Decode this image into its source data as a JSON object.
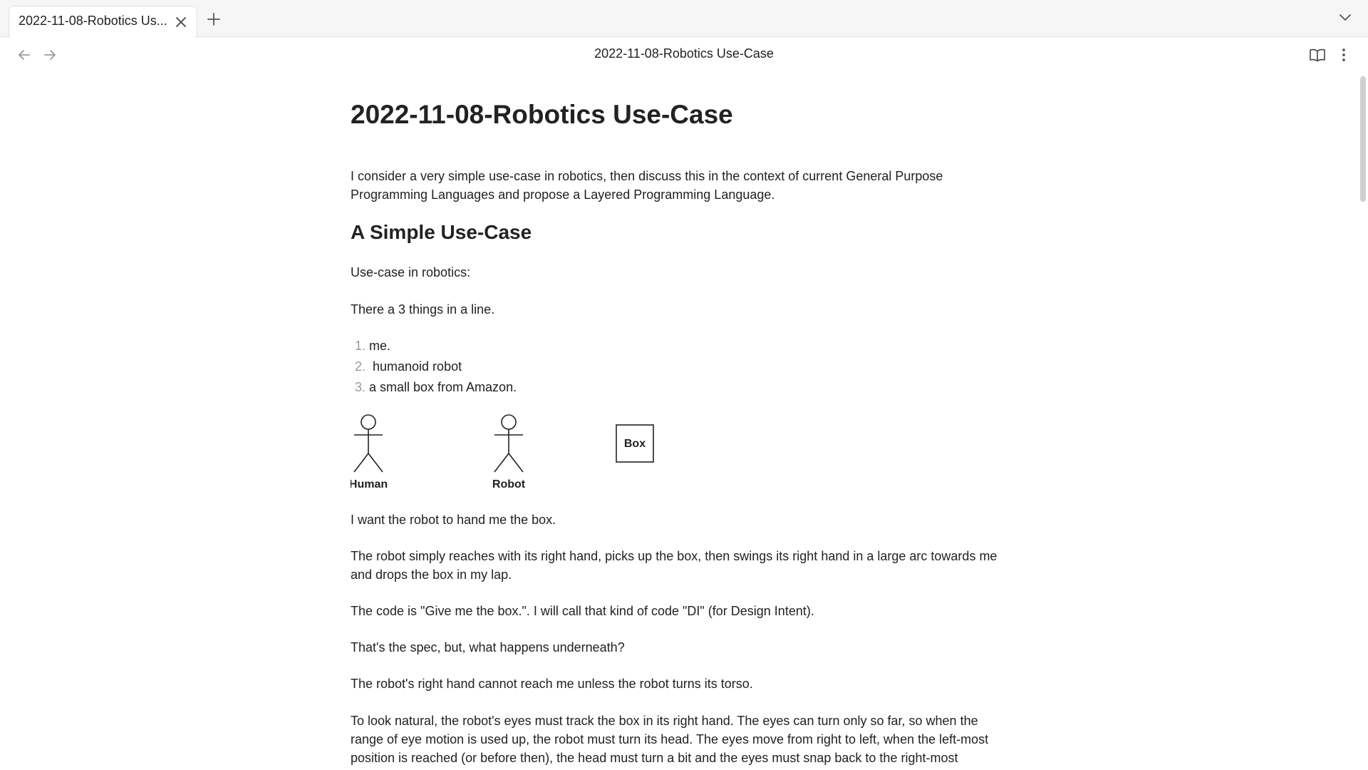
{
  "tab": {
    "title": "2022-11-08-Robotics Us..."
  },
  "navbar": {
    "title": "2022-11-08-Robotics Use-Case"
  },
  "doc": {
    "title": "2022-11-08-Robotics Use-Case",
    "intro_line1": "I consider a very simple use-case in robotics, then discuss this in the context of current General Purpose",
    "intro_line2": "Programming Languages and propose a Layered Programming Language.",
    "section1_heading": "A Simple Use-Case",
    "p_usecase": "Use-case in robotics:",
    "p_things": "There a 3 things in a line.",
    "list": [
      {
        "num": "1.",
        "text": "me."
      },
      {
        "num": "2.",
        "text": " humanoid robot"
      },
      {
        "num": "3.",
        "text": "a small box from Amazon."
      }
    ],
    "figure": {
      "human_label": "Human",
      "robot_label": "Robot",
      "box_label": "Box"
    },
    "p_want": "I want the robot to hand me the box.",
    "p_reach_line1": "The robot simply reaches with its right hand, picks up the box, then swings its right hand in a large arc towards me",
    "p_reach_line2": "and drops the box in my lap.",
    "p_code": "The code is \"Give me the box.\".  I will call that kind of code \"DI\" (for Design Intent).",
    "p_spec": "That's the spec, but, what happens underneath?",
    "p_torso": "The robot's right hand cannot reach me unless the robot turns its torso.",
    "p_eyes_line1": "To look natural, the robot's eyes must track the box in its right hand.  The eyes can turn only so far, so when the",
    "p_eyes_line2": "range of eye motion is used up, the robot must turn its head.  The eyes move from right to left, when the left-most",
    "p_eyes_line3": "position is reached (or before then), the head must turn a bit and the eyes must snap back to the right-most"
  },
  "icons": {
    "tab_close": "close-icon",
    "new_tab": "plus-icon",
    "tab_menu": "chevron-down-icon",
    "back": "arrow-left-icon",
    "forward": "arrow-right-icon",
    "reading_view": "book-open-icon",
    "more": "more-vertical-icon"
  }
}
